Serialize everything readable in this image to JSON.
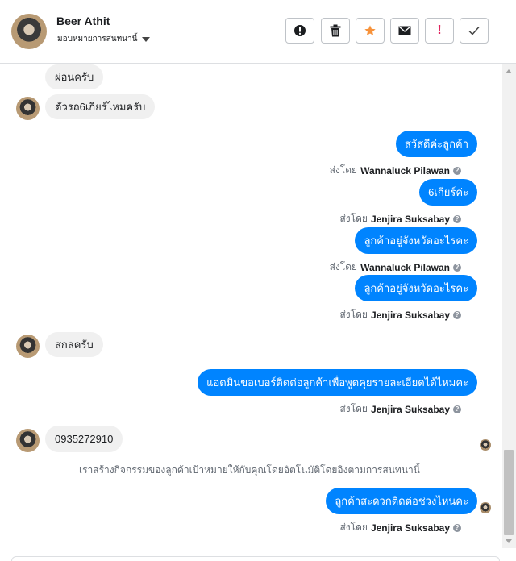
{
  "header": {
    "contact_name": "Beer Athit",
    "assign_label": "มอบหมายการสนทนานี้",
    "actions": {
      "spam": "!",
      "colors": {
        "star": "#f7923a",
        "mark_important": "#e0245e"
      }
    }
  },
  "messages": {
    "m1": "ผ่อนครับ",
    "m2": "ตัวรถ6เกียร์ไหมครับ",
    "m3": "สวัสดีค่ะลูกค้า",
    "m3_sent_prefix": "ส่งโดย",
    "m3_sender": "Wannaluck Pilawan",
    "m4": "6เกียร์ค่ะ",
    "m4_sent_prefix": "ส่งโดย",
    "m4_sender": "Jenjira Suksabay",
    "m5": "ลูกค้าอยู่จังหวัดอะไรคะ",
    "m5_sent_prefix": "ส่งโดย",
    "m5_sender": "Wannaluck Pilawan",
    "m6": "ลูกค้าอยู่จังหวัดอะไรคะ",
    "m6_sent_prefix": "ส่งโดย",
    "m6_sender": "Jenjira Suksabay",
    "m7": "สกลครับ",
    "m8": "แอดมินขอเบอร์ติดต่อลูกค้าเพื่อพูดคุยรายละเอียดได้ไหมคะ",
    "m8_sent_prefix": "ส่งโดย",
    "m8_sender": "Jenjira Suksabay",
    "m9": "0935272910",
    "notice": "เราสร้างกิจกรรมของลูกค้าเป้าหมายให้กับคุณโดยอัตโนมัติโดยอิงตามการสนทนานี้",
    "m10": "ลูกค้าสะดวกติดต่อช่วงไหนคะ",
    "m10_sent_prefix": "ส่งโดย",
    "m10_sender": "Jenjira Suksabay",
    "help_glyph": "?"
  },
  "colors": {
    "outgoing_bubble": "#0084ff",
    "incoming_bubble": "#f0f0f0"
  }
}
